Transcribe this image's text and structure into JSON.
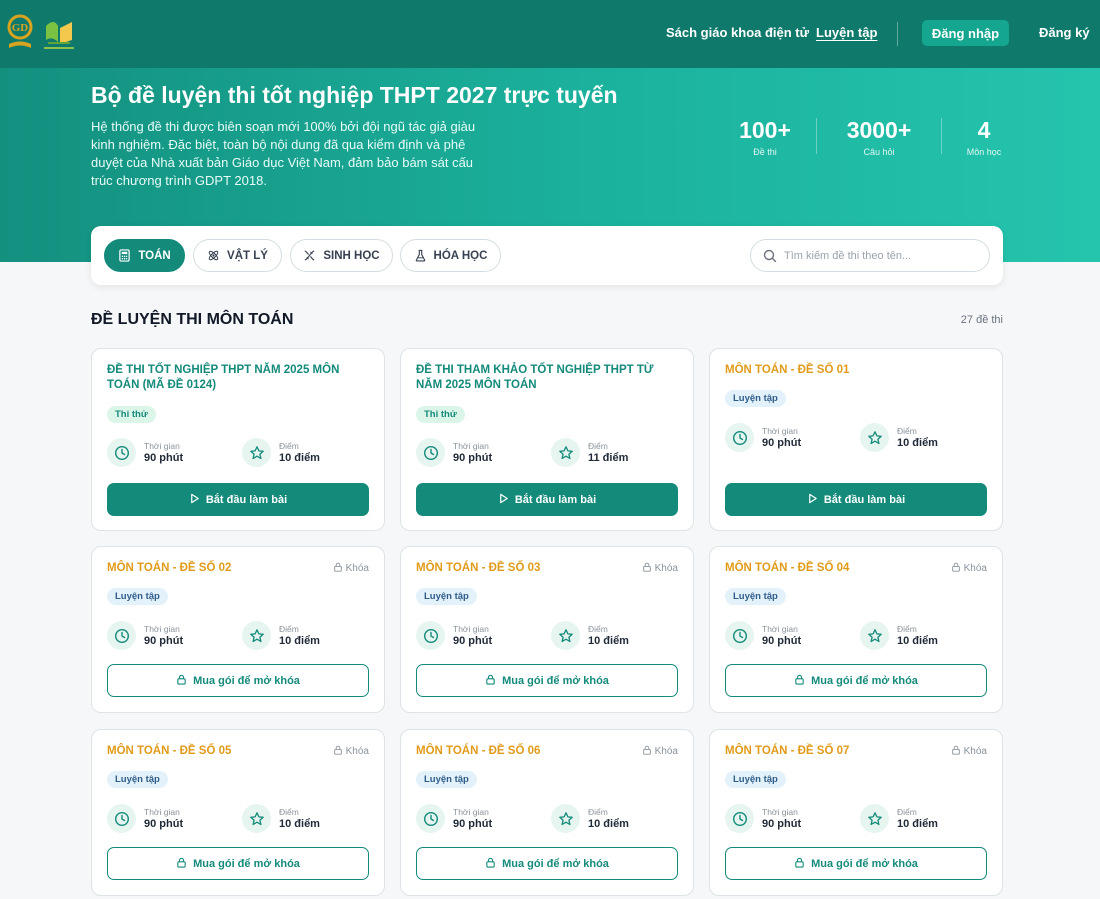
{
  "nav": {
    "links": [
      "Sách giáo khoa điện tử",
      "Luyện tập"
    ],
    "login": "Đăng nhập",
    "register": "Đăng ký"
  },
  "hero": {
    "title": "Bộ đề luyện thi tốt nghiệp THPT 2027 trực tuyến",
    "description": "Hệ thống đề thi được biên soạn mới 100% bởi đội ngũ tác giả giàu kinh nghiệm. Đặc biệt, toàn bộ nội dung đã qua kiểm định và phê duyệt của Nhà xuất bản Giáo dục Việt Nam, đảm bảo bám sát cấu trúc chương trình GDPT 2018.",
    "stats": [
      {
        "value": "100+",
        "label": "Đề thi"
      },
      {
        "value": "3000+",
        "label": "Câu hỏi"
      },
      {
        "value": "4",
        "label": "Môn học"
      }
    ]
  },
  "subjects": [
    {
      "label": "TOÁN",
      "icon": "calculator-icon",
      "active": true
    },
    {
      "label": "VẬT LÝ",
      "icon": "atom-icon",
      "active": false
    },
    {
      "label": "SINH HỌC",
      "icon": "dna-icon",
      "active": false
    },
    {
      "label": "HÓA HỌC",
      "icon": "flask-icon",
      "active": false
    }
  ],
  "search": {
    "placeholder": "Tìm kiếm đề thi theo tên..."
  },
  "section": {
    "title": "ĐỀ LUYỆN THI MÔN TOÁN",
    "count": "27 đề thi"
  },
  "labels": {
    "time": "Thời gian",
    "score": "Điểm",
    "start": "Bắt đầu làm bài",
    "unlock": "Mua gói để mở khóa",
    "locked": "Khóa"
  },
  "exams": [
    {
      "title": "ĐỀ THI TỐT NGHIỆP THPT NĂM 2025 MÔN TOÁN (MÃ ĐỀ 0124)",
      "badge": "Thi thử",
      "time": "90 phút",
      "score": "10 điểm",
      "locked": false
    },
    {
      "title": "ĐỀ THI THAM KHẢO TỐT NGHIỆP THPT TỪ NĂM 2025 MÔN TOÁN",
      "badge": "Thi thử",
      "time": "90 phút",
      "score": "11 điểm",
      "locked": false
    },
    {
      "title": "MÔN TOÁN - ĐỀ SỐ 01",
      "badge": "Luyện tập",
      "time": "90 phút",
      "score": "10 điểm",
      "locked": false
    },
    {
      "title": "MÔN TOÁN - ĐỀ SỐ 02",
      "badge": "Luyện tập",
      "time": "90 phút",
      "score": "10 điểm",
      "locked": true
    },
    {
      "title": "MÔN TOÁN - ĐỀ SỐ 03",
      "badge": "Luyện tập",
      "time": "90 phút",
      "score": "10 điểm",
      "locked": true
    },
    {
      "title": "MÔN TOÁN - ĐỀ SỐ 04",
      "badge": "Luyện tập",
      "time": "90 phút",
      "score": "10 điểm",
      "locked": true
    },
    {
      "title": "MÔN TOÁN - ĐỀ SỐ 05",
      "badge": "Luyện tập",
      "time": "90 phút",
      "score": "10 điểm",
      "locked": true
    },
    {
      "title": "MÔN TOÁN - ĐỀ SỐ 06",
      "badge": "Luyện tập",
      "time": "90 phút",
      "score": "10 điểm",
      "locked": true
    },
    {
      "title": "MÔN TOÁN - ĐỀ SỐ 07",
      "badge": "Luyện tập",
      "time": "90 phút",
      "score": "10 điểm",
      "locked": true
    }
  ],
  "colors": {
    "brand": "#148a7b",
    "header": "#0f7a6c",
    "accent_orange": "#e09b1a"
  }
}
